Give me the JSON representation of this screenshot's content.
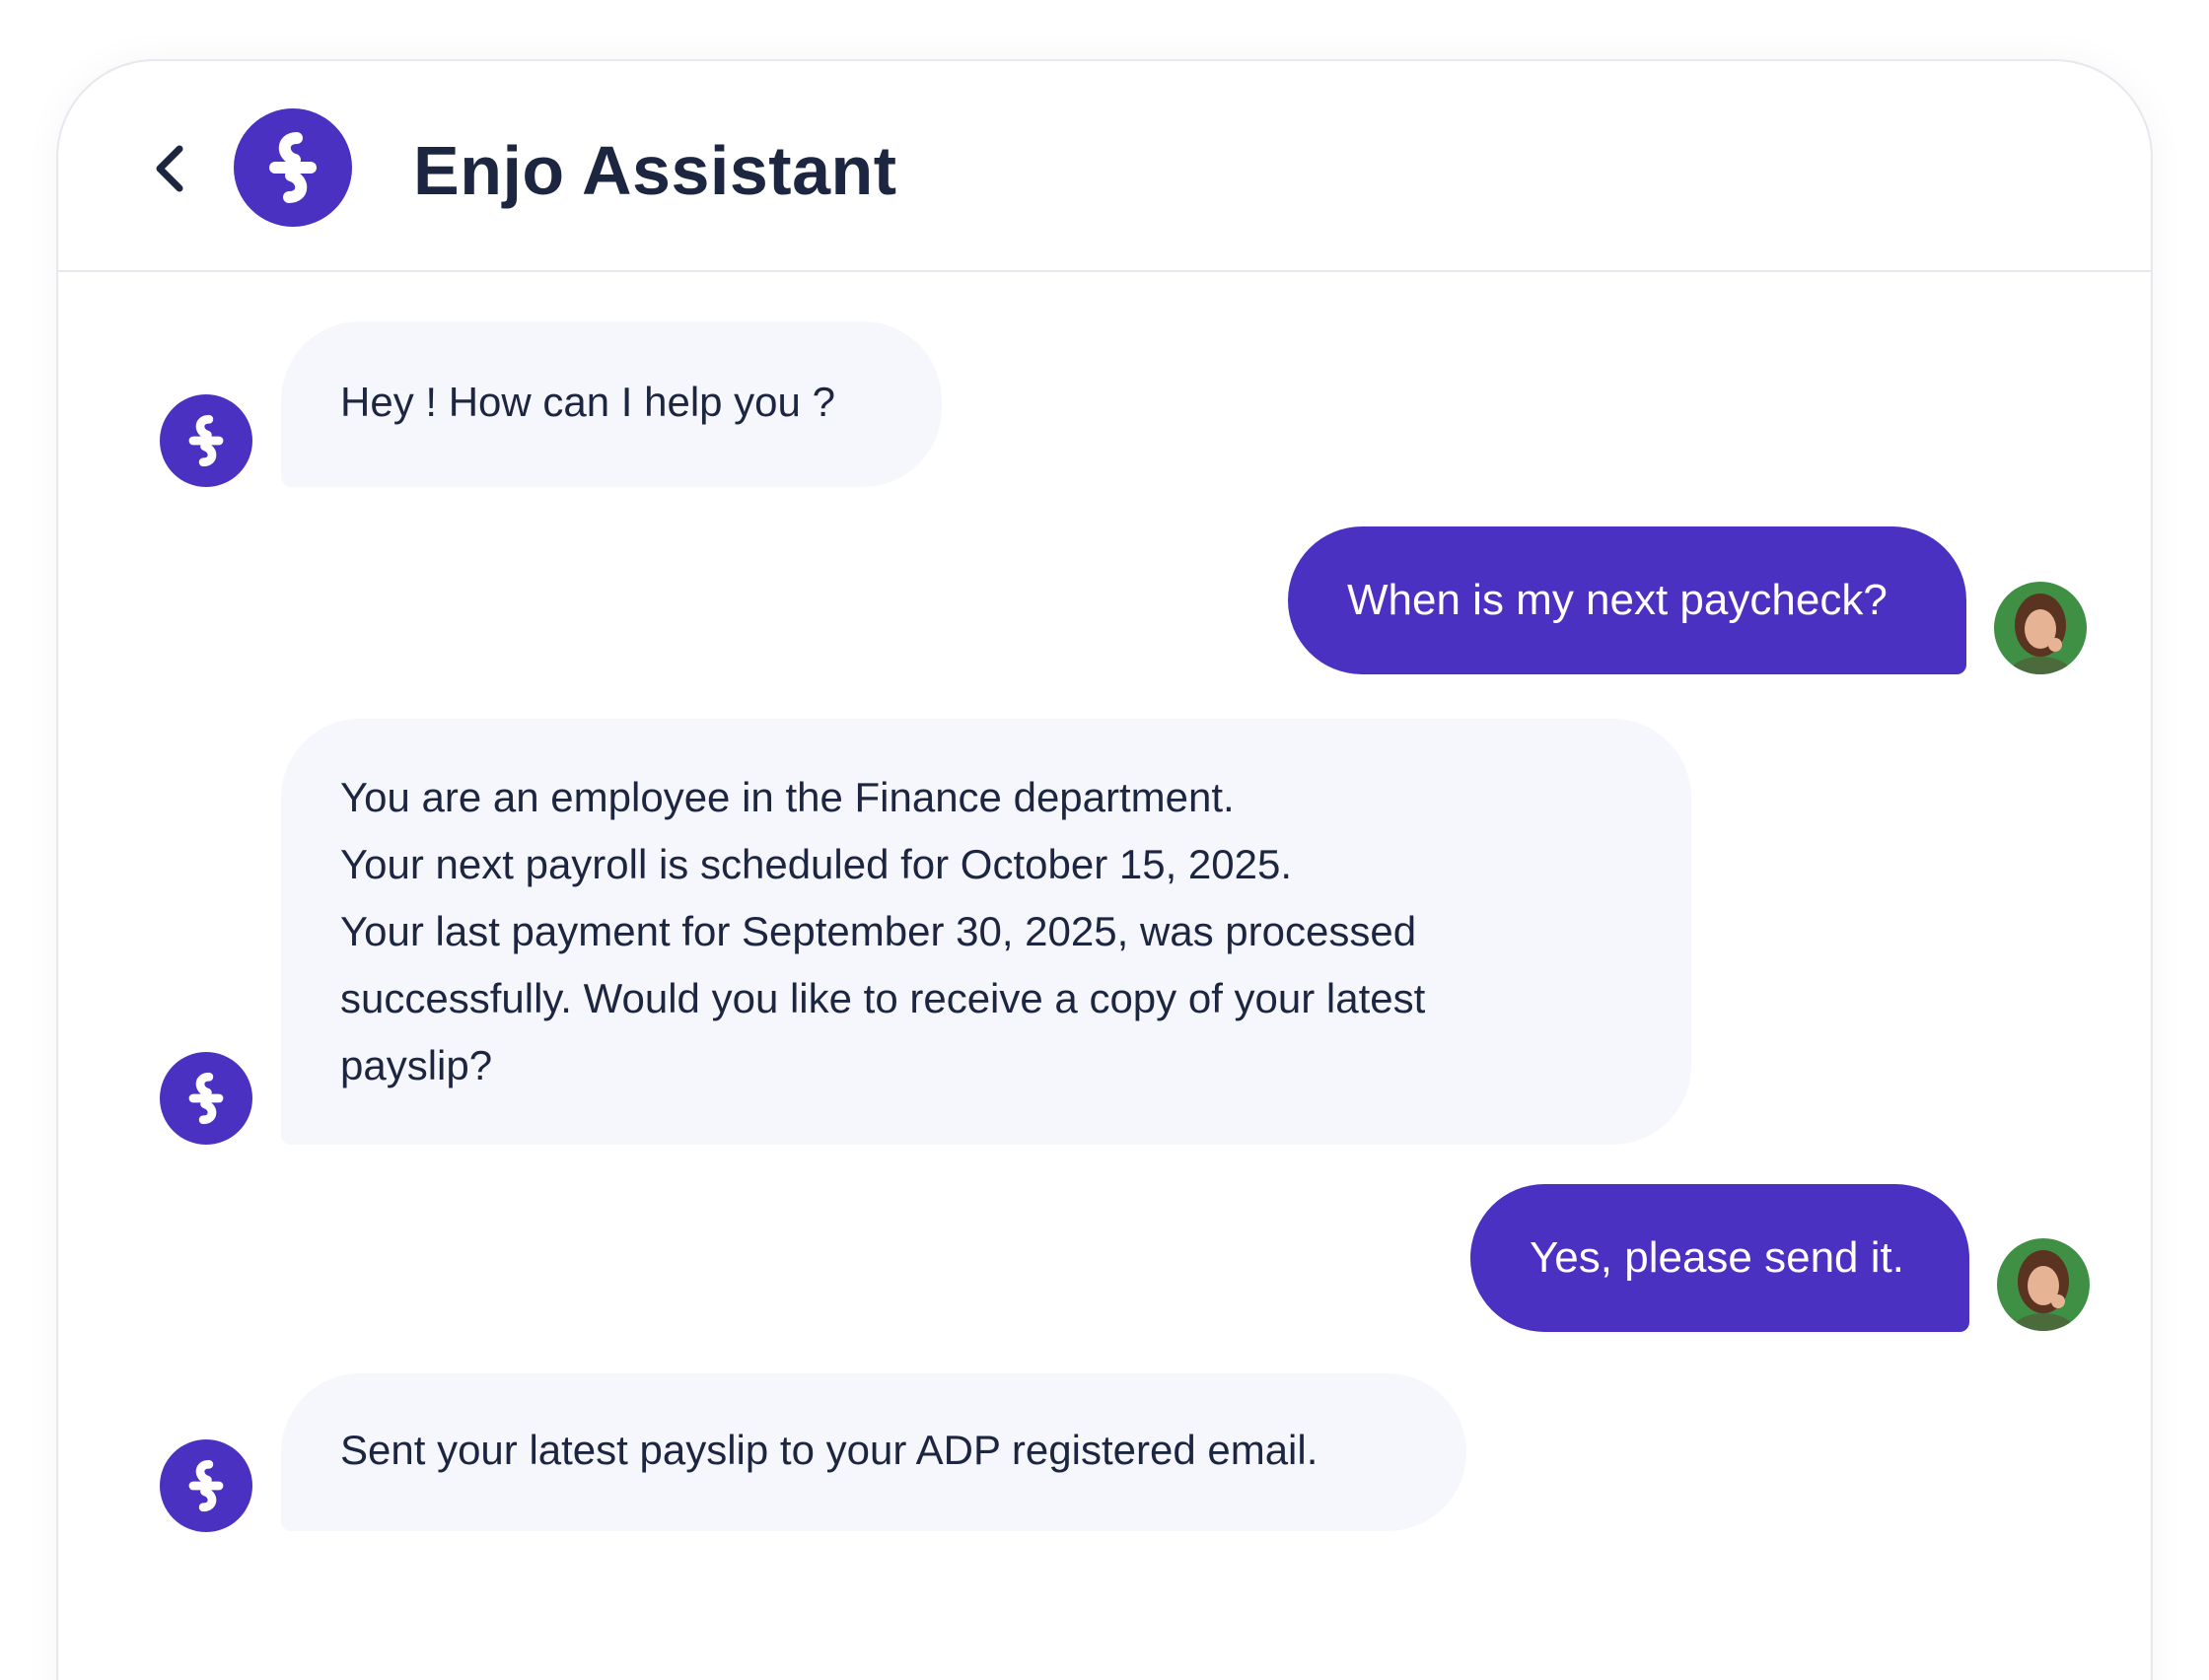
{
  "header": {
    "title": "Enjo Assistant",
    "back_icon": "chevron-left-icon",
    "logo_icon": "enjo-logo-icon"
  },
  "colors": {
    "accent": "#4a31c1",
    "bot_bubble_bg": "#f6f7fc",
    "text": "#1c2640",
    "user_text": "#ffffff"
  },
  "messages": [
    {
      "sender": "bot",
      "lines": [
        "Hey ! How can I help you ?"
      ]
    },
    {
      "sender": "user",
      "text": "When is my next paycheck?"
    },
    {
      "sender": "bot",
      "lines": [
        "You are an employee in the Finance department.",
        "Your next payroll is scheduled for October 15, 2025.",
        "Your last payment for September 30, 2025, was processed",
        "successfully. Would you like to receive a copy of your latest",
        "payslip?"
      ]
    },
    {
      "sender": "user",
      "text": "Yes, please send it."
    },
    {
      "sender": "bot",
      "lines": [
        "Sent your latest payslip to your ADP registered email."
      ]
    }
  ]
}
